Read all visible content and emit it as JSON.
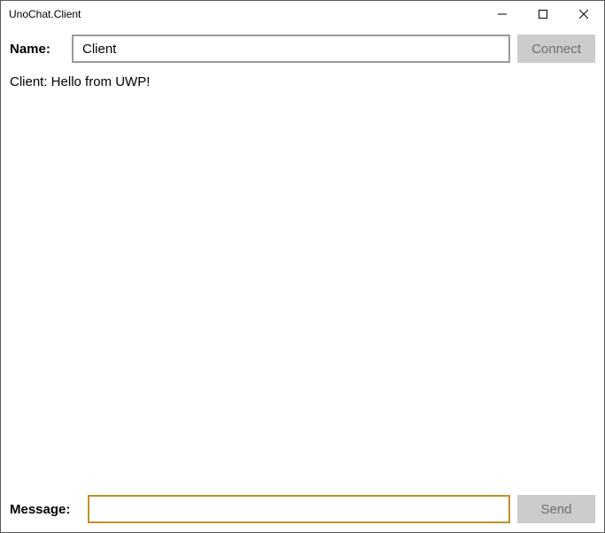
{
  "window": {
    "title": "UnoChat.Client"
  },
  "top": {
    "name_label": "Name:",
    "name_value": "Client",
    "connect_label": "Connect"
  },
  "log": {
    "lines": [
      "Client: Hello from UWP!"
    ]
  },
  "bottom": {
    "message_label": "Message:",
    "message_value": "",
    "send_label": "Send"
  }
}
